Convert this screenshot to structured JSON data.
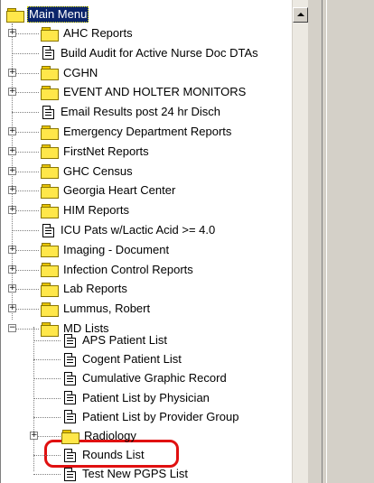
{
  "tree": {
    "root": {
      "label": "Main Menu",
      "expander": "−"
    },
    "items": [
      {
        "label": "AHC Reports",
        "type": "folder",
        "expander": "+"
      },
      {
        "label": "Build Audit for Active Nurse Doc DTAs",
        "type": "report"
      },
      {
        "label": "CGHN",
        "type": "folder",
        "expander": "+"
      },
      {
        "label": "EVENT AND HOLTER MONITORS",
        "type": "folder",
        "expander": "+"
      },
      {
        "label": "Email Results post 24 hr Disch",
        "type": "report"
      },
      {
        "label": "Emergency Department Reports",
        "type": "folder",
        "expander": "+"
      },
      {
        "label": "FirstNet Reports",
        "type": "folder",
        "expander": "+"
      },
      {
        "label": "GHC Census",
        "type": "folder",
        "expander": "+"
      },
      {
        "label": "Georgia Heart Center",
        "type": "folder",
        "expander": "+"
      },
      {
        "label": "HIM Reports",
        "type": "folder",
        "expander": "+"
      },
      {
        "label": "ICU Pats w/Lactic Acid >= 4.0",
        "type": "report"
      },
      {
        "label": "Imaging - Document",
        "type": "folder",
        "expander": "+"
      },
      {
        "label": "Infection Control Reports",
        "type": "folder",
        "expander": "+"
      },
      {
        "label": "Lab Reports",
        "type": "folder",
        "expander": "+"
      },
      {
        "label": "Lummus, Robert",
        "type": "folder",
        "expander": "+"
      },
      {
        "label": "MD Lists",
        "type": "folder",
        "expander": "−"
      }
    ],
    "md_lists_children": [
      {
        "label": "APS Patient List",
        "type": "report"
      },
      {
        "label": "Cogent Patient List",
        "type": "report"
      },
      {
        "label": "Cumulative Graphic Record",
        "type": "report"
      },
      {
        "label": "Patient List by Physician",
        "type": "report"
      },
      {
        "label": "Patient List by Provider Group",
        "type": "report"
      },
      {
        "label": "Radiology",
        "type": "folder",
        "expander": "+"
      },
      {
        "label": "Rounds List",
        "type": "report"
      },
      {
        "label": "Test New PGPS List",
        "type": "report"
      }
    ]
  },
  "colors": {
    "selection": "#0a246a",
    "folder": "#ffe74a",
    "highlight_outline": "#e01010"
  },
  "icons": {
    "scroll_up": "triangle-up-icon",
    "folder": "folder-icon",
    "report": "document-icon"
  }
}
